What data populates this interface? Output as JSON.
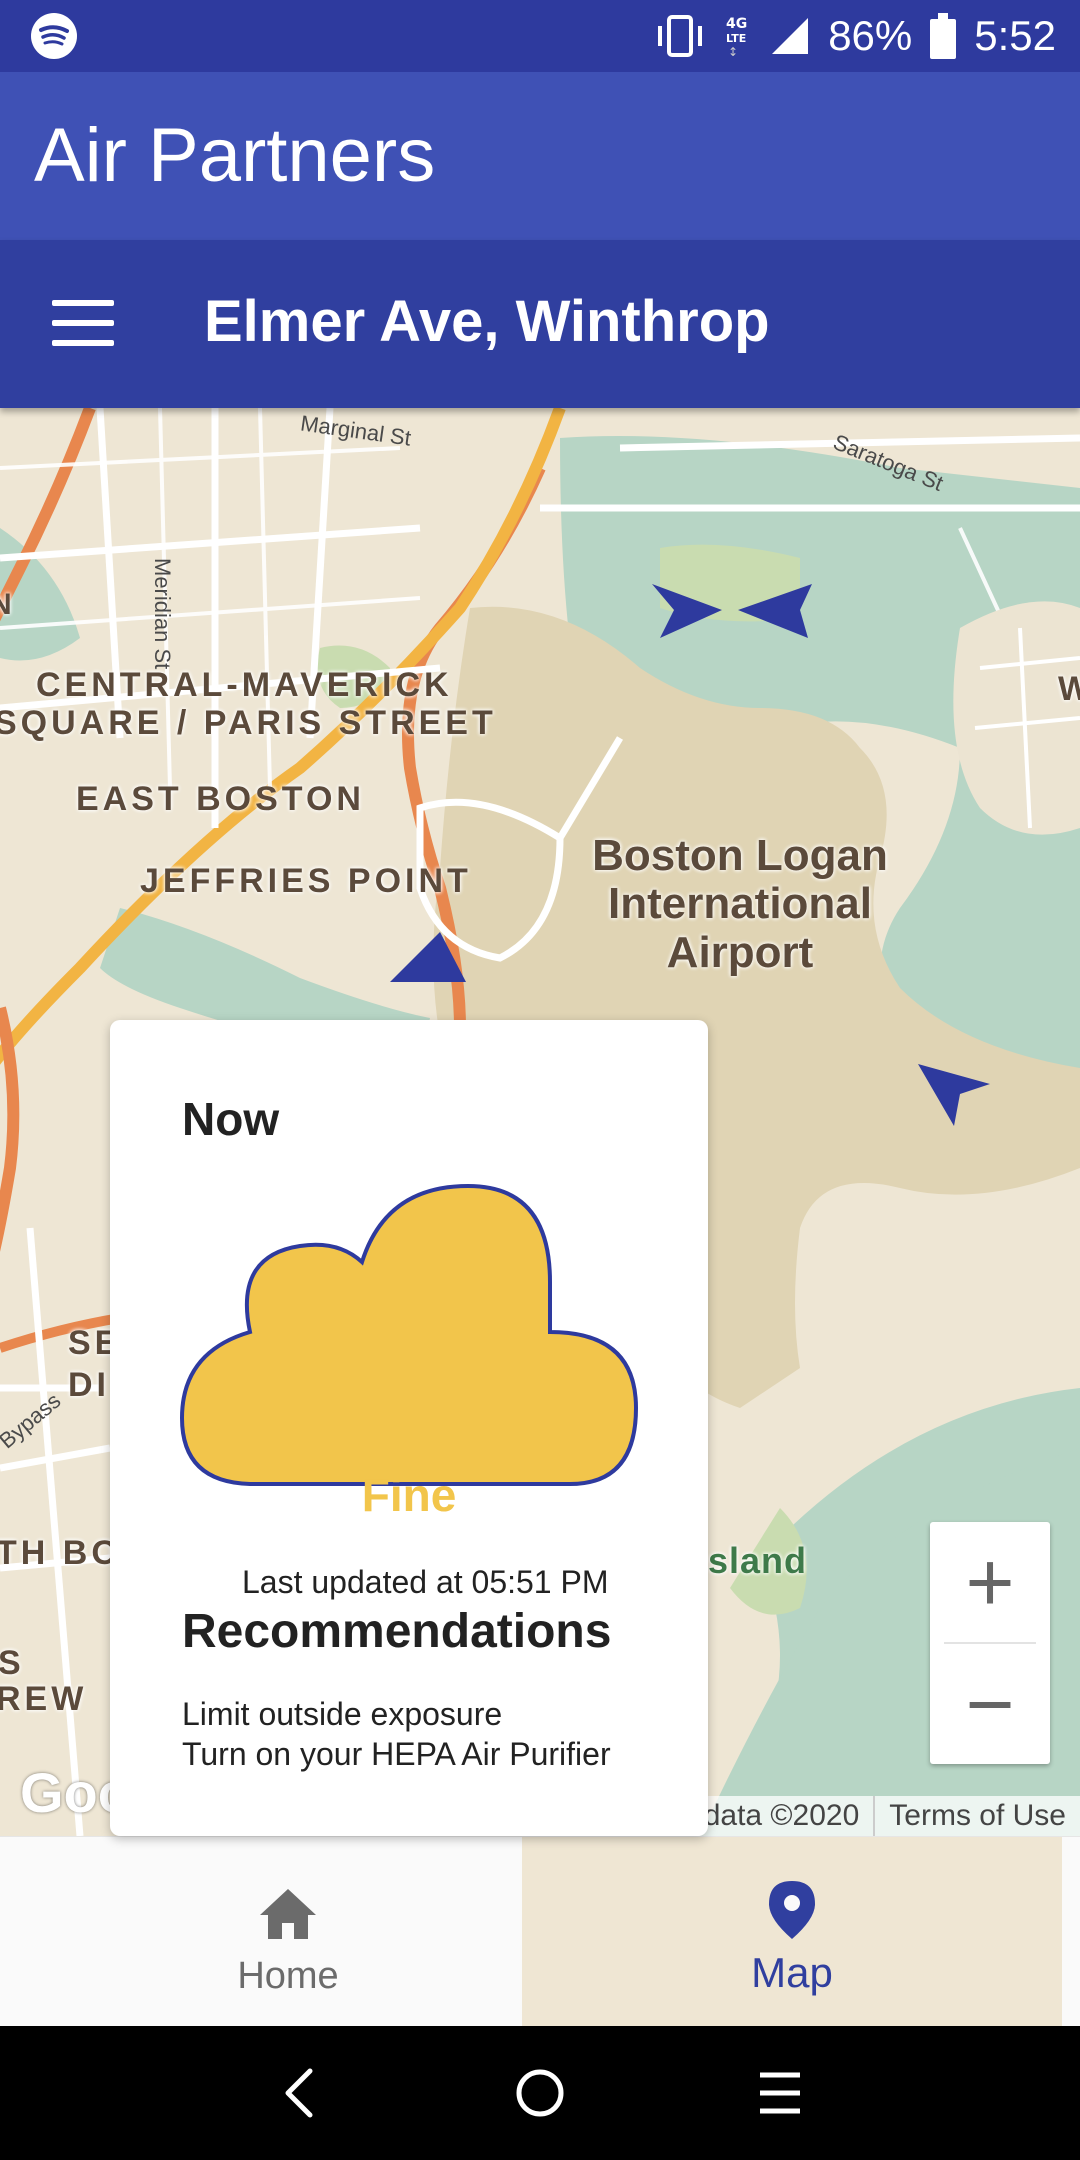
{
  "status_bar": {
    "app_icon": "spotify-icon",
    "icons": [
      "vibrate-icon",
      "4g-lte-icon",
      "signal-icon"
    ],
    "battery": "86%",
    "time": "5:52"
  },
  "app": {
    "title": "Air Partners",
    "primary_color": "#3f51b5",
    "dark_color": "#303f9f"
  },
  "location_bar": {
    "menu_icon": "hamburger-menu-icon",
    "location": "Elmer Ave, Winthrop"
  },
  "map": {
    "labels": {
      "central_maverick_1": "CENTRAL-MAVERICK",
      "central_maverick_2": "SQUARE / PARIS STREET",
      "east_boston": "EAST BOSTON",
      "jeffries_point": "JEFFRIES POINT",
      "airport": "Boston Logan International Airport",
      "island": "sland",
      "se": "SE",
      "di": "DI",
      "th_bo": "TH BO",
      "s": "S",
      "rew": "REW",
      "w": "W",
      "n": "N"
    },
    "streets": {
      "marginal": "Marginal St",
      "saratoga": "Saratoga St",
      "meridian": "Meridian St",
      "bypass": "Bypass"
    },
    "marker_color": "#2e3a9e",
    "zoom_in": "+",
    "zoom_out": "−",
    "attribution": "Map data ©2020",
    "terms": "Terms of Use",
    "logo": "Google"
  },
  "card": {
    "heading": "Now",
    "icon": "cloud-icon",
    "cloud_color": "#f2c54b",
    "status": "Fine",
    "last_updated": "Last updated at 05:51 PM",
    "recommendations_title": "Recommendations",
    "recommendations": [
      "Limit outside exposure",
      "Turn on your HEPA Air Purifier"
    ]
  },
  "bottom_nav": {
    "items": [
      {
        "label": "Home",
        "icon": "home-icon",
        "active": false
      },
      {
        "label": "Map",
        "icon": "map-pin-icon",
        "active": true
      }
    ]
  },
  "system_nav": {
    "icons": [
      "back-icon",
      "home-circle-icon",
      "recents-icon"
    ]
  }
}
